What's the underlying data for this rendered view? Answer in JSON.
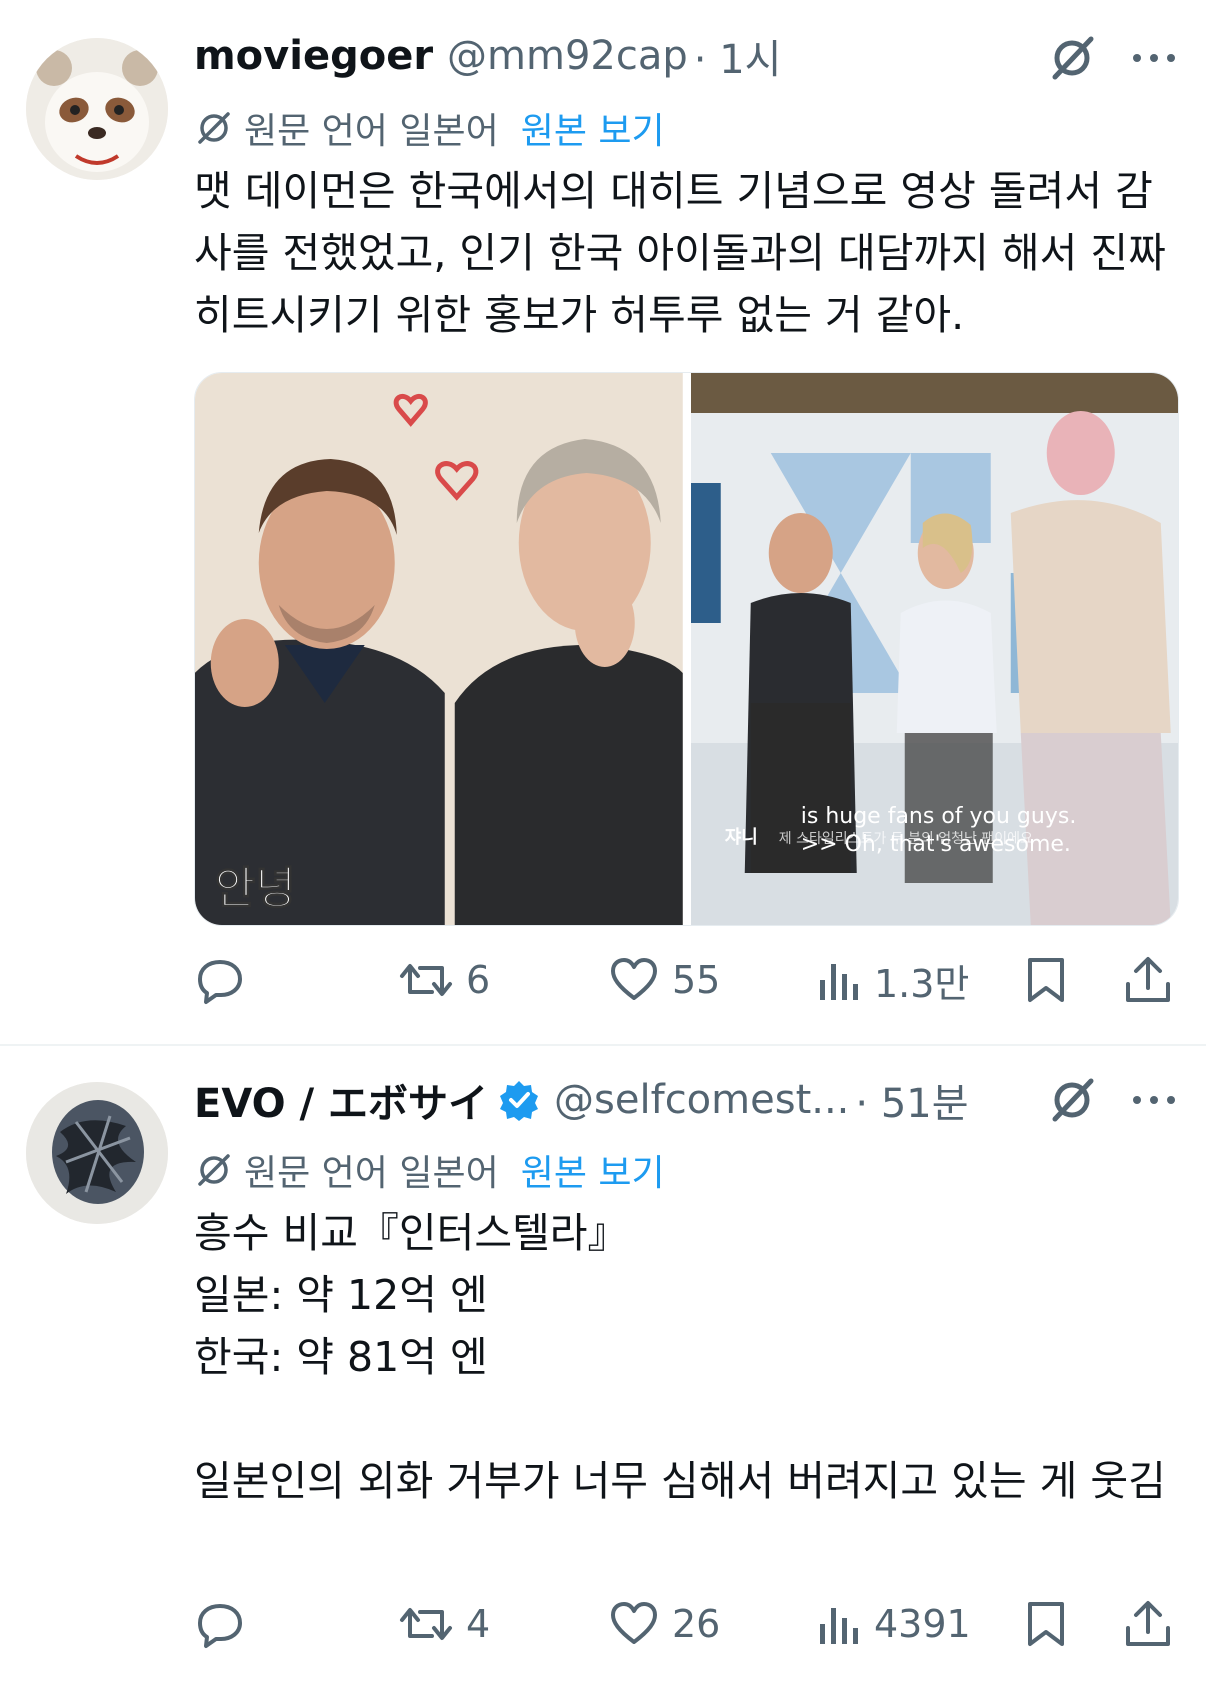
{
  "tweets": [
    {
      "display_name": "moviegoer",
      "handle": "@mm92cap",
      "time": "· 1시",
      "translate": {
        "label": "원문 언어 일본어",
        "view_original": "원본 보기"
      },
      "text": "맷 데이먼은 한국에서의 대히트 기념으로 영상 돌려서 감사를 전했었고, 인기 한국 아이돌과의 대담까지 해서 진짜 히트시키기 위한 홍보가 허투루 없는 거 같아.",
      "media": {
        "left_caption": "안녕",
        "right_sub_en_1": "is huge fans of you guys.",
        "right_sub_en_2": ">> Oh, that's awesome.",
        "right_sub_kr_name": "쟈니",
        "right_sub_kr": "제 스타일리스트가 두 분의 엄청난 팬이에요"
      },
      "stats": {
        "replies": "",
        "retweets": "6",
        "likes": "55",
        "views": "1.3만"
      }
    },
    {
      "display_name": "EVO / エボサイ",
      "handle": "@selfcomest...",
      "time": "· 51분",
      "translate": {
        "label": "원문 언어 일본어",
        "view_original": "원본 보기"
      },
      "text": "흥수 비교『인터스텔라』\n일본: 약 12억 엔\n한국: 약 81억 엔\n\n일본인의 외화 거부가 너무 심해서 버려지고 있는 게 웃김",
      "stats": {
        "replies": "",
        "retweets": "4",
        "likes": "26",
        "views": "4391"
      }
    }
  ],
  "colors": {
    "accent": "#1d9bf0",
    "secondary_text": "#536471",
    "primary_text": "#0f1419",
    "verified": "#1d9bf0"
  }
}
